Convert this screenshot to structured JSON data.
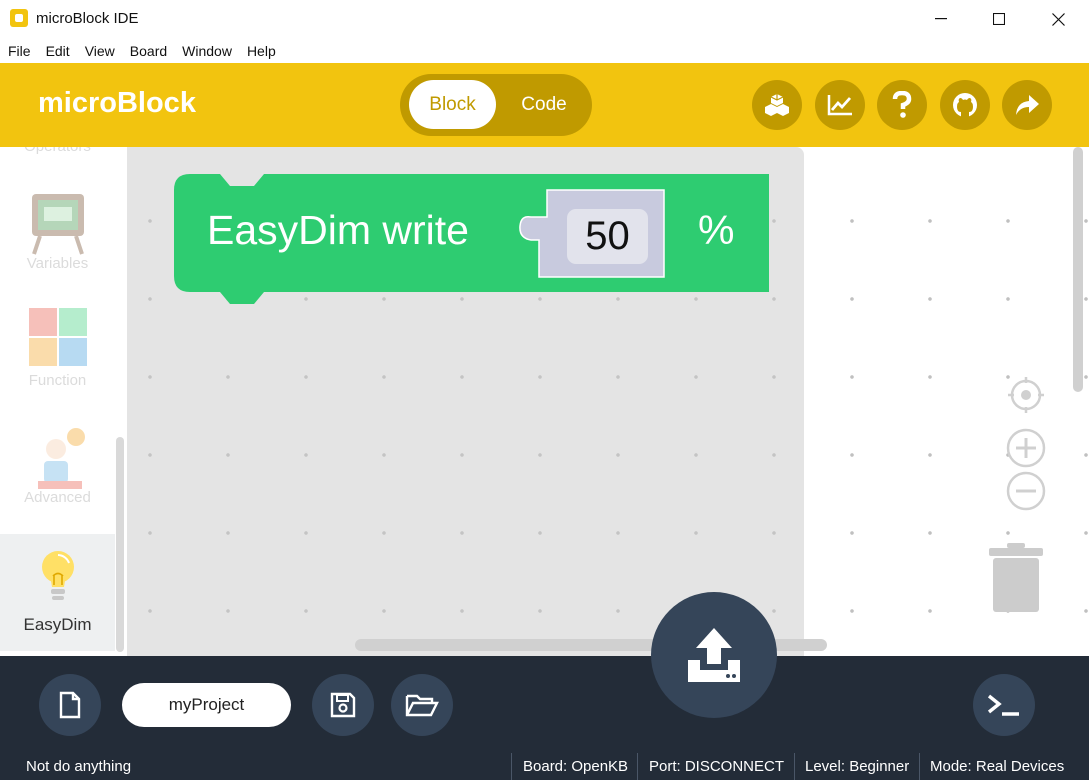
{
  "window": {
    "title": "microBlock IDE",
    "minimize": "—",
    "maximize": "☐",
    "close": "✕"
  },
  "menu": [
    "File",
    "Edit",
    "View",
    "Board",
    "Window",
    "Help"
  ],
  "header": {
    "brand": "microBlock",
    "mode_block": "Block",
    "mode_code": "Code",
    "buttons": [
      "extensions-icon",
      "chart-icon",
      "help-icon",
      "github-icon",
      "share-icon"
    ],
    "accent_color": "#f2c40f",
    "accent_dark": "#c09a00"
  },
  "palette": {
    "categories": [
      {
        "label": "Operators",
        "icon": "operators-icon"
      },
      {
        "label": "Variables",
        "icon": "variables-icon"
      },
      {
        "label": "Function",
        "icon": "function-icon"
      },
      {
        "label": "Advanced",
        "icon": "advanced-icon"
      },
      {
        "label": "EasyDim",
        "icon": "lightbulb-icon",
        "active": true
      }
    ]
  },
  "workspace": {
    "block": {
      "label": "EasyDim write",
      "value": "50",
      "unit": "%",
      "color": "#2ecc71"
    }
  },
  "bottom": {
    "project_name": "myProject",
    "buttons": [
      "new-file-icon",
      "save-icon",
      "open-folder-icon",
      "upload-icon",
      "terminal-icon"
    ]
  },
  "status": {
    "message": "Not do anything",
    "board": "Board: OpenKB",
    "port": "Port: DISCONNECT",
    "level": "Level: Beginner",
    "mode": "Mode: Real Devices"
  }
}
